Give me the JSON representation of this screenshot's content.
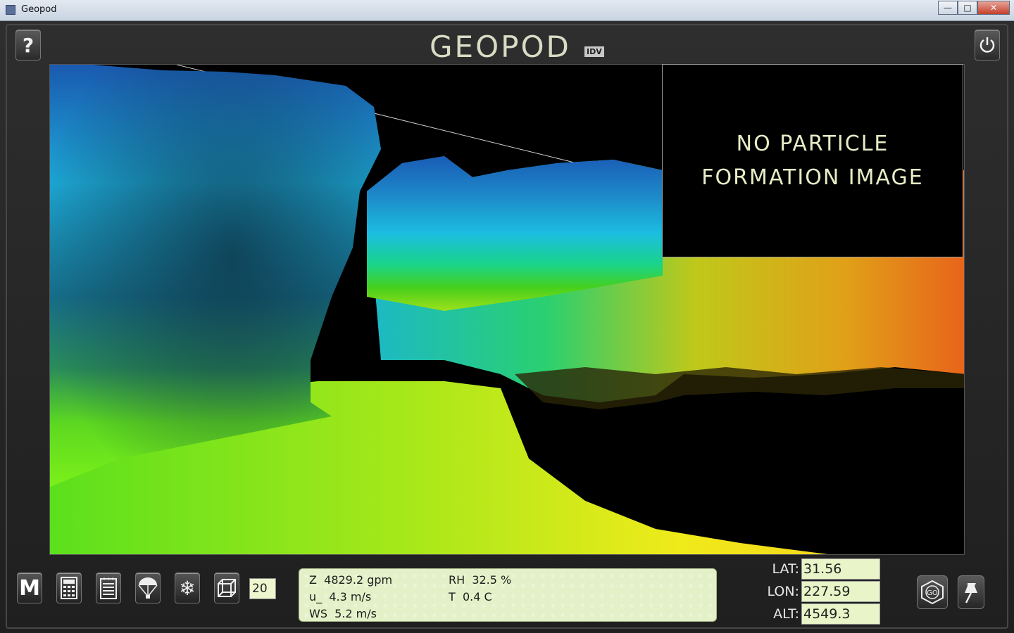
{
  "window": {
    "title": "Geopod",
    "minimize": "—",
    "maximize": "□",
    "close": "✕"
  },
  "header": {
    "logo": "GEOPOD",
    "logo_sub": "IDV"
  },
  "icons": {
    "help": "help-icon",
    "power": "power-icon",
    "menu": "M",
    "calculator": "calculator-icon",
    "notepad": "notepad-icon",
    "parachute": "parachute-icon",
    "snowflake": "snowflake-icon",
    "cube": "cube-icon",
    "go": "GO",
    "pin": "pushpin-icon"
  },
  "particle_panel": {
    "line1": "NO PARTICLE",
    "line2": "FORMATION IMAGE"
  },
  "toolbar": {
    "count_value": "20"
  },
  "readout": {
    "z": "Z  4829.2 gpm",
    "u": "u_  4.3 m/s",
    "ws": "WS  5.2 m/s",
    "rh": "RH  32.5 %",
    "t": "T  0.4 C"
  },
  "coords": {
    "lat_label": "LAT:",
    "lat_value": "31.56",
    "lon_label": "LON:",
    "lon_value": "227.59",
    "alt_label": "ALT:",
    "alt_value": "4549.3"
  },
  "colors": {
    "terrain_high": "#1a5fb0",
    "terrain_mid": "#1bb7d8",
    "terrain_low": "#7ee61c",
    "terrain_lowest": "#f2e21a",
    "terrain_accent": "#e07a1a",
    "readout_bg": "#e4f1c8"
  }
}
